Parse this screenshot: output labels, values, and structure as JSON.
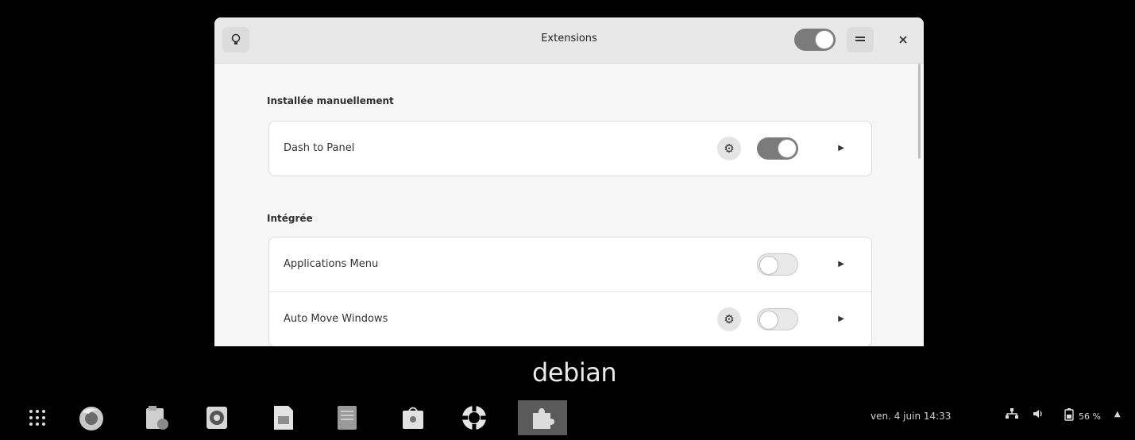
{
  "window": {
    "title": "Extensions",
    "icons": {
      "tips": "lightbulb-icon",
      "menu": "hamburger-menu-icon",
      "close": "close-icon"
    },
    "global_toggle_on": true
  },
  "sections": [
    {
      "title": "Installée manuellement",
      "items": [
        {
          "label": "Dash to Panel",
          "has_settings": true,
          "enabled": true
        }
      ]
    },
    {
      "title": "Intégrée",
      "items": [
        {
          "label": "Applications Menu",
          "has_settings": false,
          "enabled": false
        },
        {
          "label": "Auto Move Windows",
          "has_settings": true,
          "enabled": false
        }
      ]
    }
  ],
  "desktop": {
    "logo_text": "debian"
  },
  "taskbar": {
    "apps": [
      {
        "name": "show-apps-icon"
      },
      {
        "name": "firefox-icon"
      },
      {
        "name": "files-icon"
      },
      {
        "name": "rhythmbox-icon"
      },
      {
        "name": "libreoffice-writer-icon"
      },
      {
        "name": "text-editor-icon"
      },
      {
        "name": "software-center-icon"
      },
      {
        "name": "help-icon"
      },
      {
        "name": "extensions-icon",
        "active": true
      }
    ],
    "clock": "ven. 4 juin  14:33",
    "battery": "56 %",
    "status_icons": [
      "network-icon",
      "volume-icon",
      "battery-icon",
      "arrow-up-icon"
    ]
  }
}
